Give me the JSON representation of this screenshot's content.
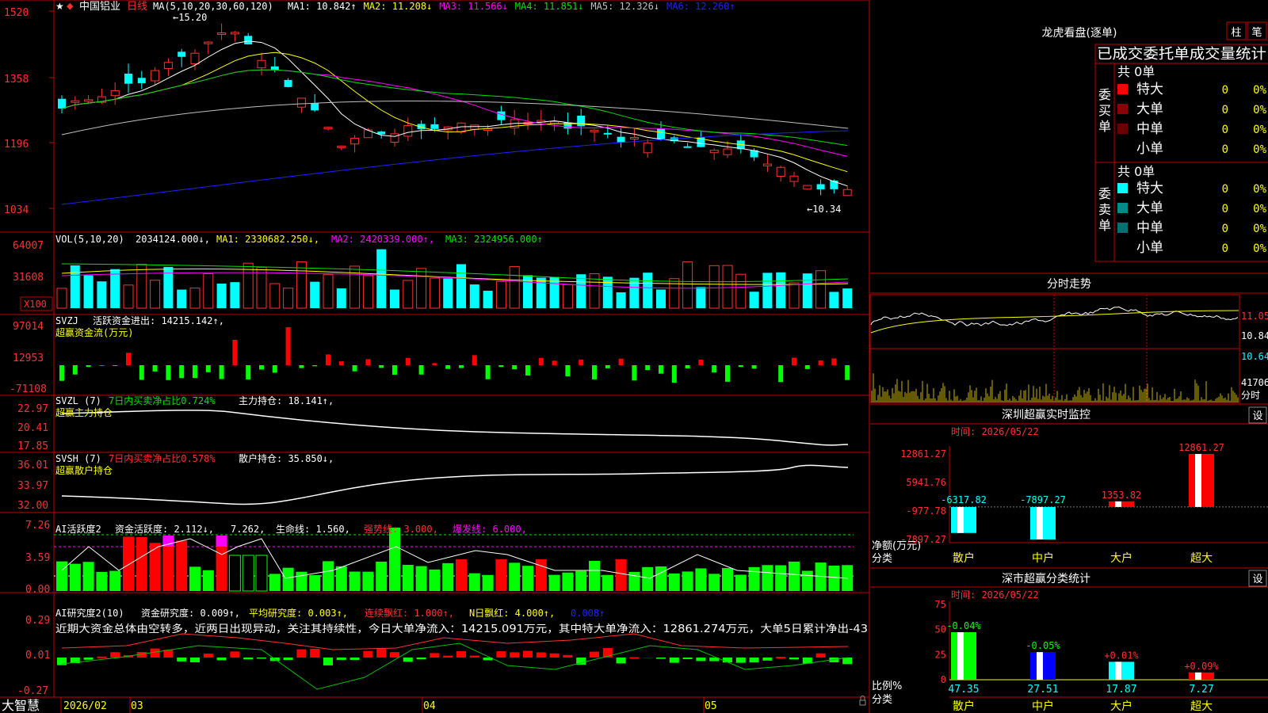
{
  "app_name": "大智慧",
  "stock": {
    "name": "中国铝业",
    "period": "日线"
  },
  "price_panel": {
    "ma_label": "MA(5,10,20,30,60,120)",
    "ma_values": [
      {
        "text": "MA1: 10.842↑",
        "color": "#ffffff"
      },
      {
        "text": "MA2: 11.208↓",
        "color": "#ffff00"
      },
      {
        "text": "MA3: 11.566↓",
        "color": "#ff00ff"
      },
      {
        "text": "MA4: 11.851↓",
        "color": "#00e000"
      },
      {
        "text": "MA5: 12.326↓",
        "color": "#c0c0c0"
      },
      {
        "text": "MA6: 12.260↑",
        "color": "#2020ff"
      }
    ],
    "high_label": "←15.20",
    "low_label": "←10.34",
    "y_ticks": [
      "1520",
      "1358",
      "1196",
      "1034"
    ]
  },
  "vol_panel": {
    "label": "VOL(5,10,20)",
    "value": "2034124.000↓,",
    "ma": [
      {
        "text": "MA1: 2330682.250↓,",
        "color": "#ffff00"
      },
      {
        "text": "MA2: 2420339.000↑,",
        "color": "#ff00ff"
      },
      {
        "text": "MA3: 2324956.000↑",
        "color": "#00e000"
      }
    ],
    "y_ticks": [
      "64007",
      "31608"
    ],
    "unit": "X100"
  },
  "svzj_panel": {
    "label": "SVZJ",
    "desc": "活跃资金进出: 14215.142↑,",
    "sub": "超赢资金流(万元)",
    "y_ticks": [
      "97014",
      "12953",
      "-71108"
    ]
  },
  "svzl_panel": {
    "label": "SVZL (7)",
    "desc1": "7日内买卖净占比0.724%",
    "desc2": "主力持仓: 18.141↑,",
    "sub": "超赢主力持仓",
    "y_ticks": [
      "22.97",
      "20.41",
      "17.85"
    ]
  },
  "svsh_panel": {
    "label": "SVSH (7)",
    "desc1": "7日内买卖净占比0.578%",
    "desc2": "散户持仓: 35.850↓,",
    "sub": "超赢散户持仓",
    "y_ticks": [
      "36.01",
      "33.97",
      "32.00"
    ]
  },
  "ai_active_panel": {
    "label": "AI活跃度2",
    "desc1": "资金活跃度: 2.112↓,",
    "desc2": "7.262,",
    "desc3": "生命线: 1.560,",
    "desc4": "强势线: 3.000,",
    "desc5": "爆发线: 6.000,",
    "y_ticks": [
      "7.26",
      "3.59",
      "0.00"
    ]
  },
  "ai_research_panel": {
    "label": "AI研究度2(10)",
    "desc1": "资金研究度: 0.009↑,",
    "desc2": "平均研究度: 0.003↑,",
    "desc3": "连续飘红: 1.000↑,",
    "desc4": "N日飘红: 4.000↑,",
    "desc5": "0.008↑",
    "comment": "近期大资金总体由空转多，近两日出现异动，关注其持续性，今日大单净流入：14215.091万元，其中特大单净流入：12861.274万元，大单5日累计净出-43",
    "y_ticks": [
      "0.29",
      "0.01",
      "-0.27"
    ]
  },
  "date_axis": [
    "2026/02",
    "03",
    "04",
    "05"
  ],
  "right": {
    "lhb_title": "龙虎看盘(逐单)",
    "btn_zhu": "柱",
    "btn_bi": "笔",
    "stats_title": "已成交委托单成交量统计",
    "buy_label": "委买单",
    "sell_label": "委卖单",
    "buy_total": "共 0单",
    "sell_total": "共 0单",
    "buy_rows": [
      {
        "name": "特大",
        "count": "0",
        "pct": "0%",
        "color": "#ff0000"
      },
      {
        "name": "大单",
        "count": "0",
        "pct": "0%",
        "color": "#8b0000"
      },
      {
        "name": "中单",
        "count": "0",
        "pct": "0%",
        "color": "#6a0000"
      },
      {
        "name": "小单",
        "count": "0",
        "pct": "0%",
        "color": ""
      }
    ],
    "sell_rows": [
      {
        "name": "特大",
        "count": "0",
        "pct": "0%",
        "color": "#00ffff"
      },
      {
        "name": "大单",
        "count": "0",
        "pct": "0%",
        "color": "#008b8b"
      },
      {
        "name": "中单",
        "count": "0",
        "pct": "0%",
        "color": "#007070"
      },
      {
        "name": "小单",
        "count": "0",
        "pct": "0%",
        "color": ""
      }
    ],
    "intraday_title": "分时走势",
    "intraday_ticks": [
      "11.05",
      "10.84",
      "10.64"
    ],
    "intraday_vol": "41706",
    "intraday_unit": "分时",
    "sz_title": "深圳超赢实时监控",
    "sz_time": "时间: 2026/05/22",
    "sz_setting": "设",
    "sz_ticks": [
      "12861.27",
      "5941.76",
      "-977.78",
      "-7897.27"
    ],
    "sz_ylabel": "净额(万元)",
    "sz_xlabel": "分类",
    "sc_title": "深市超赢分类统计",
    "sc_time": "时间: 2026/05/22",
    "sc_setting": "设",
    "sc_ticks": [
      "75",
      "50",
      "25",
      "0"
    ],
    "sc_ylabel": "比例%",
    "sc_xlabel": "分类"
  },
  "chart_data": [
    {
      "type": "bar",
      "title": "深圳超赢实时监控",
      "ylabel": "净额(万元)",
      "categories": [
        "散户",
        "中户",
        "大户",
        "超大"
      ],
      "values": [
        -6317.82,
        -7897.27,
        1353.82,
        12861.27
      ],
      "ylim": [
        -7897.27,
        12861.27
      ],
      "colors": [
        "#00ffff",
        "#00ffff",
        "#ff0000",
        "#ff0000"
      ]
    },
    {
      "type": "bar",
      "title": "深市超赢分类统计",
      "ylabel": "比例%",
      "categories": [
        "散户",
        "中户",
        "大户",
        "超大"
      ],
      "values": [
        47.35,
        27.51,
        17.87,
        7.27
      ],
      "changes": [
        "-0.04%",
        "-0.05%",
        "+0.01%",
        "+0.09%"
      ],
      "ylim": [
        0,
        75
      ],
      "colors": [
        "#00ff00",
        "#0000ff",
        "#00ffff",
        "#ff0000"
      ]
    }
  ]
}
